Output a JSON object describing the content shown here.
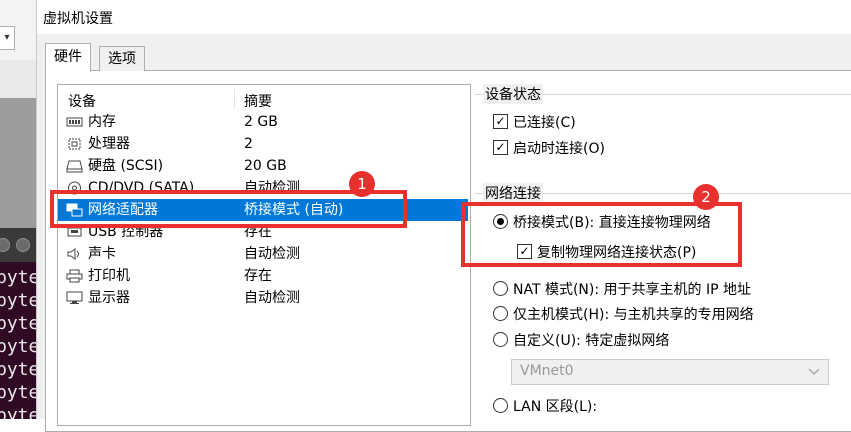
{
  "background": {
    "dropdown_glyph": "▾",
    "terminal_lines": [
      "pyte",
      "pyte",
      "pyte",
      "pyte",
      "pyte",
      "pyte",
      "pyte"
    ]
  },
  "dialog": {
    "title": "虚拟机设置",
    "tabs": [
      {
        "label": "硬件",
        "active": true
      },
      {
        "label": "选项",
        "active": false
      }
    ]
  },
  "device_list": {
    "headers": {
      "device": "设备",
      "summary": "摘要"
    },
    "rows": [
      {
        "icon": "memory-icon",
        "name": "内存",
        "summary": "2 GB",
        "selected": false
      },
      {
        "icon": "processor-icon",
        "name": "处理器",
        "summary": "2",
        "selected": false
      },
      {
        "icon": "hard-disk-icon",
        "name": "硬盘 (SCSI)",
        "summary": "20 GB",
        "selected": false
      },
      {
        "icon": "cd-dvd-icon",
        "name": "CD/DVD (SATA)",
        "summary": "自动检测",
        "selected": false
      },
      {
        "icon": "network-adapter-icon",
        "name": "网络适配器",
        "summary": "桥接模式 (自动)",
        "selected": true
      },
      {
        "icon": "usb-icon",
        "name": "USB 控制器",
        "summary": "存在",
        "selected": false
      },
      {
        "icon": "speaker-icon",
        "name": "声卡",
        "summary": "自动检测",
        "selected": false
      },
      {
        "icon": "printer-icon",
        "name": "打印机",
        "summary": "存在",
        "selected": false
      },
      {
        "icon": "monitor-icon",
        "name": "显示器",
        "summary": "自动检测",
        "selected": false
      }
    ]
  },
  "device_status": {
    "title": "设备状态",
    "connected": {
      "label": "已连接(C)",
      "checked": true
    },
    "connect_at_power_on": {
      "label": "启动时连接(O)",
      "checked": true
    }
  },
  "network_connection": {
    "title": "网络连接",
    "bridged": {
      "label": "桥接模式(B): 直接连接物理网络",
      "selected": true
    },
    "replicate": {
      "label": "复制物理网络连接状态(P)",
      "checked": true
    },
    "nat": {
      "label": "NAT 模式(N): 用于共享主机的 IP 地址",
      "selected": false
    },
    "host_only": {
      "label": "仅主机模式(H): 与主机共享的专用网络",
      "selected": false
    },
    "custom": {
      "label": "自定义(U): 特定虚拟网络",
      "selected": false
    },
    "custom_network_select": {
      "value": "VMnet0",
      "disabled": true
    },
    "lan_segment": {
      "label": "LAN 区段(L):",
      "selected": false
    }
  },
  "annotations": {
    "badge_1": "1",
    "badge_2": "2",
    "accent_color": "#e8302f",
    "selection_color": "#0078d7"
  }
}
